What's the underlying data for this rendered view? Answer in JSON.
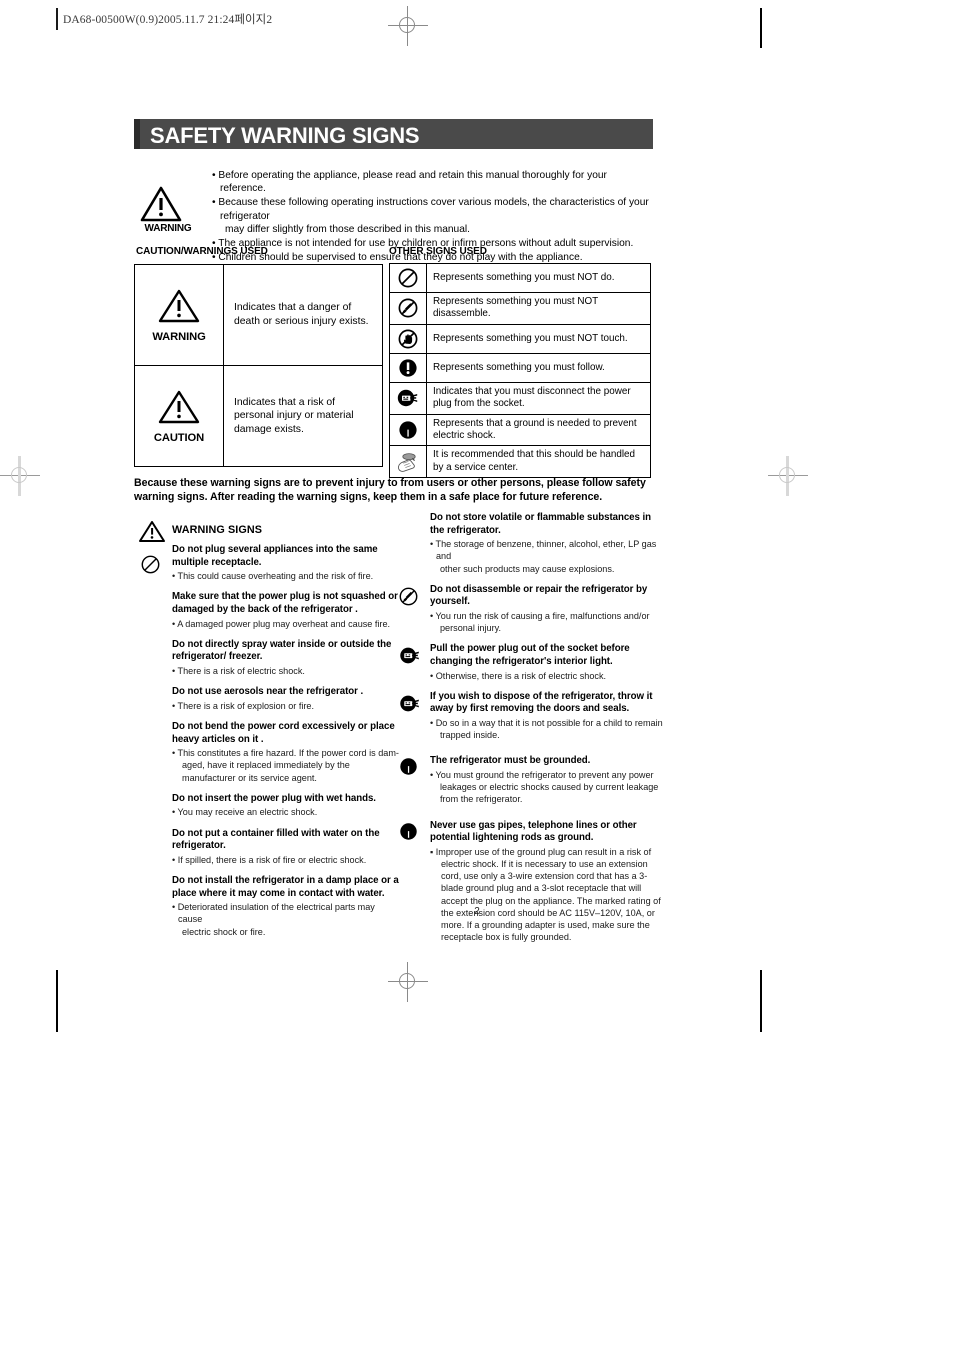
{
  "doc": {
    "code_line": "DA68-00500W(0.9)2005.11.7 21:24페이지2",
    "page_number": "2"
  },
  "header": {
    "title": "SAFETY WARNING SIGNS"
  },
  "intro": {
    "icon_label": "WARNING",
    "bullets": [
      {
        "text": "Before operating the appliance, please read and retain this manual thoroughly for your reference.",
        "cont": ""
      },
      {
        "text": "Because these following operating instructions cover various models, the characteristics of your refrigerator",
        "cont": "may differ slightly from those described in this manual."
      },
      {
        "text": "The appliance is not intended for use by children or infirm persons without adult supervision.",
        "cont": ""
      },
      {
        "text": "Children should be supervised to ensure that they do not play with the appliance.",
        "cont": ""
      }
    ]
  },
  "caution_table": {
    "label": "CAUTION/WARNINGS USED",
    "rows": [
      {
        "icon": "warning-triangle-icon",
        "symbol_label": "WARNING",
        "description": "Indicates that a danger of death or serious injury exists."
      },
      {
        "icon": "caution-triangle-icon",
        "symbol_label": "CAUTION",
        "description": "Indicates that a risk of personal injury or material damage exists."
      }
    ]
  },
  "other_table": {
    "label": "OTHER SIGNS USED",
    "rows": [
      {
        "icon": "prohibited-circle-icon",
        "description": "Represents something you must NOT do."
      },
      {
        "icon": "no-disassemble-icon",
        "description": "Represents something you must NOT disassemble."
      },
      {
        "icon": "no-touch-icon",
        "description": "Represents something you must NOT touch."
      },
      {
        "icon": "mandatory-exclamation-icon",
        "description": "Represents something you must follow."
      },
      {
        "icon": "unplug-icon",
        "description": "Indicates that you must disconnect the power plug from the socket."
      },
      {
        "icon": "ground-icon",
        "description": "Represents that a ground is needed to prevent electric shock."
      },
      {
        "icon": "service-center-hand-icon",
        "description": "It is recommended that this should be handled by a service center."
      }
    ]
  },
  "lead_paragraph": "Because these warning signs are to prevent injury to from users or other persons, please follow safety warning signs. After reading the warning signs, keep them in a safe place for future reference.",
  "warning_signs": {
    "heading": "WARNING SIGNS",
    "heading_icon": "warning-triangle-icon",
    "left_column": [
      {
        "icon": "prohibited-circle-icon",
        "head": "Do not plug several appliances into the same multiple receptacle.",
        "bullets": [
          {
            "text": "This could cause overheating and the risk of fire.",
            "cont": ""
          }
        ]
      },
      {
        "icon": "",
        "head": "Make sure that the power plug is not squashed or damaged by the back of the refrigerator .",
        "bullets": [
          {
            "text": "A damaged power plug may overheat and cause fire.",
            "cont": ""
          }
        ]
      },
      {
        "icon": "",
        "head": "Do not directly spray water inside or outside the refrigerator/ freezer.",
        "bullets": [
          {
            "text": "There is a risk of electric shock.",
            "cont": ""
          }
        ]
      },
      {
        "icon": "",
        "head": "Do not use aerosols near the refrigerator .",
        "bullets": [
          {
            "text": "There is a risk of explosion or fire.",
            "cont": ""
          }
        ]
      },
      {
        "icon": "",
        "head": "Do not bend the power cord excessively or place heavy articles on it .",
        "bullets": [
          {
            "text": "This constitutes a fire hazard. If the power cord is dam-",
            "cont": "aged, have it replaced immediately by the manufacturer or its service agent."
          }
        ]
      },
      {
        "icon": "",
        "head": "Do not insert the power plug with wet hands.",
        "bullets": [
          {
            "text": "You may receive an electric shock.",
            "cont": ""
          }
        ]
      },
      {
        "icon": "",
        "head": "Do not put a container filled with water on the refrigerator.",
        "bullets": [
          {
            "text": "If spilled, there is a risk of fire or electric shock.",
            "cont": ""
          }
        ]
      },
      {
        "icon": "",
        "head": "Do not install the refrigerator  in a damp place or a place where it may come in contact with water.",
        "bullets": [
          {
            "text": "Deteriorated insulation of the electrical parts may cause",
            "cont": "electric shock or fire."
          }
        ]
      }
    ],
    "right_column": [
      {
        "icon": "",
        "head": "Do not store volatile or flammable substances in the refrigerator.",
        "bullets": [
          {
            "text": "The storage of benzene, thinner, alcohol, ether, LP gas and",
            "cont": "other such products may cause explosions."
          }
        ]
      },
      {
        "icon": "no-disassemble-icon",
        "head": "Do not disassemble or repair the refrigerator by yourself.",
        "bullets": [
          {
            "text": "You run the risk of causing a fire, malfunctions and/or",
            "cont": "personal injury."
          }
        ]
      },
      {
        "icon": "unplug-icon",
        "head": "Pull the power plug out of the socket before changing the refrigerator's interior light.",
        "bullets": [
          {
            "text": "Otherwise, there is a risk of electric shock.",
            "cont": ""
          }
        ]
      },
      {
        "icon": "unplug-icon",
        "head": "If you wish to dispose of the refrigerator, throw it away by first removing the doors and seals.",
        "bullets": [
          {
            "text": "Do so in a way that it is not possible for a child to remain",
            "cont": "trapped  inside."
          }
        ]
      },
      {
        "icon": "ground-icon",
        "head": "The refrigerator must be grounded.",
        "bullets": [
          {
            "text": "You must ground the refrigerator to prevent any power",
            "cont": "leakages or electric shocks caused by current leakage from the refrigerator."
          }
        ]
      },
      {
        "icon": "ground-icon",
        "head": "Never use gas pipes, telephone lines or other potential lightening rods as ground.",
        "bullets": [
          {
            "text": "Improper use of the ground plug can result in a risk of",
            "cont": "electric shock. If it is necessary to use an extension cord, use only a 3-wire extension cord that has a 3-blade ground plug and a 3-slot receptacle that will accept the plug on the appliance. The marked rating of the extension cord should be AC 115V–120V, 10A, or more. If a grounding adapter is used, make sure the receptacle box is fully grounded."
          }
        ]
      }
    ]
  },
  "colors": {
    "title_band": "#4a4a4a",
    "title_text": "#ffffff",
    "rule": "#000000"
  }
}
